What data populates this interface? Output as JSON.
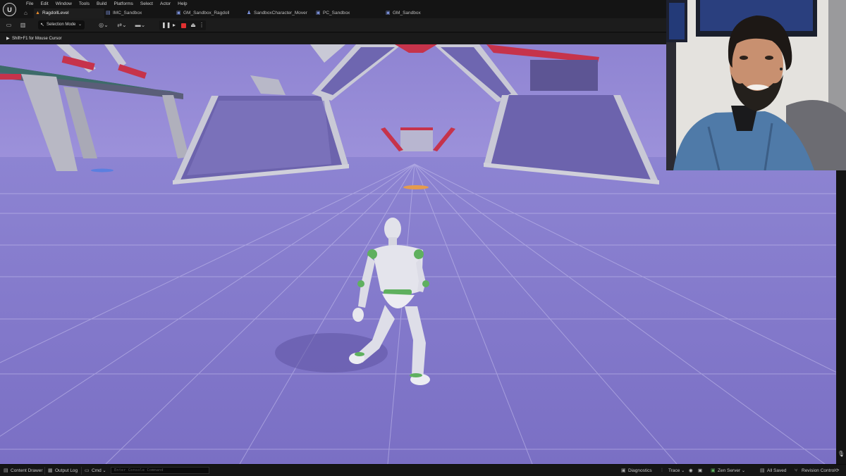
{
  "menu": [
    "File",
    "Edit",
    "Window",
    "Tools",
    "Build",
    "Platforms",
    "Select",
    "Actor",
    "Help"
  ],
  "tabs": [
    {
      "label": "RagdollLevel",
      "icon": "level-icon"
    },
    {
      "label": "IMC_Sandbox",
      "icon": "input-mapping-icon"
    },
    {
      "label": "GM_Sandbox_Ragdoll",
      "icon": "blueprint-icon"
    },
    {
      "label": "SandboxCharacter_Mover",
      "icon": "character-icon"
    },
    {
      "label": "PC_Sandbox",
      "icon": "blueprint-icon"
    },
    {
      "label": "GM_Sandbox",
      "icon": "blueprint-icon"
    }
  ],
  "toolbar": {
    "mode_label": "Selection Mode"
  },
  "viewport": {
    "hint": "Shift+F1 for Mouse Cursor"
  },
  "statusbar": {
    "content_drawer": "Content Drawer",
    "output_log": "Output Log",
    "cmd": "Cmd",
    "console_placeholder": "Enter Console Command",
    "diagnostics": "Diagnostics",
    "trace": "Trace",
    "zen_server": "Zen Server",
    "all_saved": "All Saved",
    "revision_control": "Revision Control"
  },
  "colors": {
    "floor": "#7c72c2",
    "accent_tab": "#e58a2c",
    "stop": "#e03030"
  }
}
